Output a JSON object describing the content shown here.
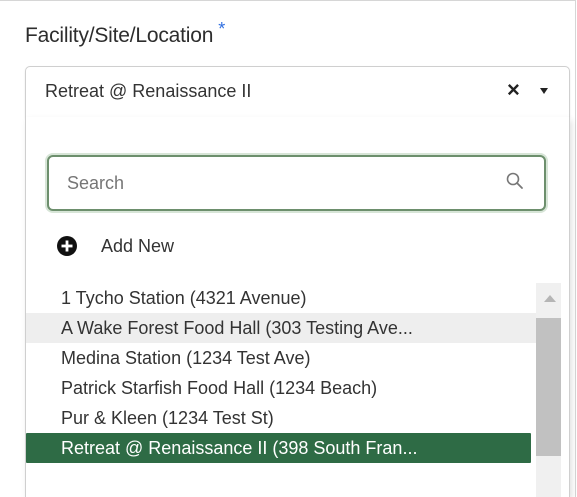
{
  "field": {
    "label": "Facility/Site/Location",
    "required_marker": "*",
    "selected_value": "Retreat @ Renaissance II",
    "clear_glyph": "×"
  },
  "dropdown": {
    "search": {
      "placeholder": "Search",
      "value": ""
    },
    "add_new_label": "Add New",
    "options": [
      {
        "label": "1 Tycho Station (4321 Avenue)",
        "state": "normal"
      },
      {
        "label": "A Wake Forest Food Hall (303 Testing Ave...",
        "state": "hover"
      },
      {
        "label": "Medina Station (1234 Test Ave)",
        "state": "normal"
      },
      {
        "label": "Patrick Starfish Food Hall (1234 Beach)",
        "state": "normal"
      },
      {
        "label": "Pur & Kleen (1234 Test St)",
        "state": "normal"
      },
      {
        "label": "Retreat @ Renaissance II (398 South Fran...",
        "state": "selected"
      }
    ]
  },
  "colors": {
    "selected_bg": "#2e6b45",
    "required": "#2f6ee0",
    "search_border": "#6d8f6d"
  },
  "icons": {
    "search": "search-icon",
    "add": "plus-circle-icon",
    "clear": "close-icon",
    "caret": "caret-down-icon"
  }
}
